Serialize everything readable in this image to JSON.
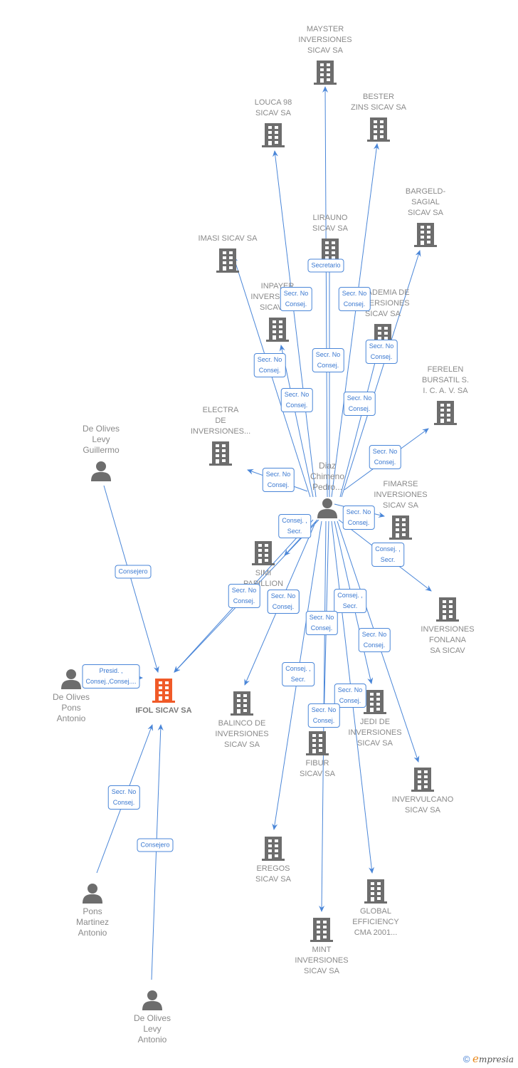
{
  "colors": {
    "edge": "#4a86d8",
    "node_gray": "#6d6d6d",
    "focus": "#f05a28",
    "label_text": "#8a8a8a"
  },
  "focus_company": {
    "name": "IFOL SICAV SA"
  },
  "central_person": {
    "name": "Diaz\nChimeno\nPedro..."
  },
  "companies": [
    {
      "id": "mayster",
      "name": "MAYSTER\nINVERSIONES\nSICAV SA"
    },
    {
      "id": "louca",
      "name": "LOUCA 98\nSICAV SA"
    },
    {
      "id": "bester",
      "name": "BESTER\nZINS SICAV SA"
    },
    {
      "id": "bargeld",
      "name": "BARGELD-\nSAGIAL\nSICAV SA"
    },
    {
      "id": "lirauno",
      "name": "LIRAUNO\nSICAV SA"
    },
    {
      "id": "imasi",
      "name": "IMASI SICAV SA"
    },
    {
      "id": "inpayer",
      "name": "INPAYER\nINVERSIONES\nSICAV SA"
    },
    {
      "id": "academia",
      "name": "ACADEMIA DE\nINVERSIONES\nSICAV SA"
    },
    {
      "id": "ferelen",
      "name": "FERELEN\nBURSATIL S.\nI. C. A. V. SA"
    },
    {
      "id": "electra",
      "name": "ELECTRA\nDE\nINVERSIONES..."
    },
    {
      "id": "fimarse",
      "name": "FIMARSE\nINVERSIONES\nSICAV SA"
    },
    {
      "id": "simi",
      "name": "SIMI\nPAPILLION"
    },
    {
      "id": "fonlana",
      "name": "INVERSIONES\nFONLANA\nSA SICAV"
    },
    {
      "id": "balinco",
      "name": "BALINCO DE\nINVERSIONES\nSICAV SA"
    },
    {
      "id": "jedi",
      "name": "JEDI DE\nINVERSIONES\nSICAV SA"
    },
    {
      "id": "fibur",
      "name": "FIBUR\nSICAV SA"
    },
    {
      "id": "intervulcano",
      "name": "INVERVULCANO\nSICAV SA"
    },
    {
      "id": "eregos",
      "name": "EREGOS\nSICAV SA"
    },
    {
      "id": "global",
      "name": "GLOBAL\nEFFICIENCY\nCMA 2001..."
    },
    {
      "id": "mint",
      "name": "MINT\nINVERSIONES\nSICAV SA"
    }
  ],
  "persons": [
    {
      "id": "guillermo",
      "name": "De Olives\nLevy\nGuillermo"
    },
    {
      "id": "pons_antonio",
      "name": "De Olives\nPons\nAntonio"
    },
    {
      "id": "pons_martinez",
      "name": "Pons\nMartinez\nAntonio"
    },
    {
      "id": "levy_antonio",
      "name": "De Olives\nLevy\nAntonio"
    }
  ],
  "edges": [
    {
      "from": "diaz",
      "to": "mayster",
      "label": "Secretario"
    },
    {
      "from": "diaz",
      "to": "louca",
      "label": "Secr.  No\nConsej."
    },
    {
      "from": "diaz",
      "to": "bester",
      "label": "Secr.  No\nConsej."
    },
    {
      "from": "diaz",
      "to": "lirauno",
      "label": "Secr.  No\nConsej."
    },
    {
      "from": "diaz",
      "to": "imasi",
      "label": "Secr.  No\nConsej."
    },
    {
      "from": "diaz",
      "to": "inpayer",
      "label": "Secr.  No\nConsej."
    },
    {
      "from": "diaz",
      "to": "bargeld",
      "label": "Secr.  No\nConsej."
    },
    {
      "from": "diaz",
      "to": "academia",
      "label": "Secr.  No\nConsej."
    },
    {
      "from": "diaz",
      "to": "ferelen",
      "label": "Secr.  No\nConsej."
    },
    {
      "from": "diaz",
      "to": "electra",
      "label": "Secr.  No\nConsej."
    },
    {
      "from": "diaz",
      "to": "fimarse",
      "label": "Secr.  No\nConsej."
    },
    {
      "from": "diaz",
      "to": "fonlana",
      "label": "Consej. ,\nSecr."
    },
    {
      "from": "diaz",
      "to": "ifol",
      "label": "Consej. ,\nSecr."
    },
    {
      "from": "diaz",
      "to": "ifol2",
      "label": "Secr.  No\nConsej."
    },
    {
      "from": "diaz",
      "to": "balinco",
      "label": "Secr.  No\nConsej."
    },
    {
      "from": "diaz",
      "to": "simi",
      "label": "Secr.  No\nConsej."
    },
    {
      "from": "diaz",
      "to": "jedi",
      "label": "Consej. ,\nSecr."
    },
    {
      "from": "diaz",
      "to": "intervulcano",
      "label": "Secr.  No\nConsej."
    },
    {
      "from": "diaz",
      "to": "eregos",
      "label": "Consej. ,\nSecr."
    },
    {
      "from": "diaz",
      "to": "fibur",
      "label": "Secr.  No\nConsej."
    },
    {
      "from": "diaz",
      "to": "global",
      "label": "Secr.  No\nConsej."
    },
    {
      "from": "diaz",
      "to": "mint",
      "label": "Secr.  No\nConsej."
    },
    {
      "from": "guillermo",
      "to": "ifol",
      "label": "Consejero"
    },
    {
      "from": "pons_antonio",
      "to": "ifol",
      "label": "Presid. ,\nConsej.,Consej...."
    },
    {
      "from": "pons_martinez",
      "to": "ifol",
      "label": "Secr.  No\nConsej."
    },
    {
      "from": "levy_antonio",
      "to": "ifol",
      "label": "Consejero"
    }
  ],
  "footer": {
    "copyright": "©",
    "brand_initial": "e",
    "brand_rest": "mpresia"
  }
}
